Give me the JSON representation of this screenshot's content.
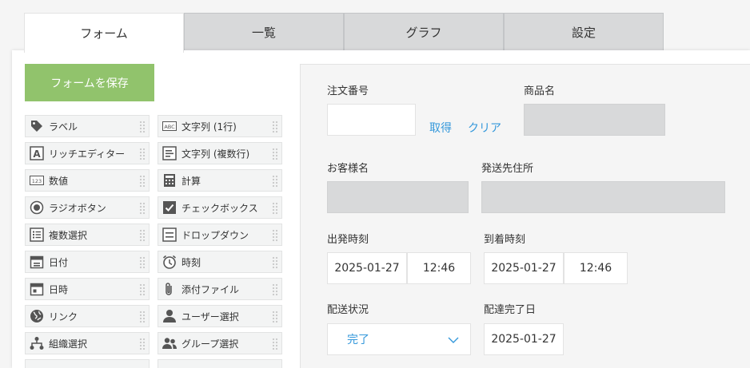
{
  "tabs": [
    {
      "label": "フォーム",
      "active": true
    },
    {
      "label": "一覧"
    },
    {
      "label": "グラフ"
    },
    {
      "label": "設定"
    }
  ],
  "save_button": "フォームを保存",
  "palette": [
    {
      "label": "ラベル",
      "icon": "tag-icon"
    },
    {
      "label": "文字列 (1行)",
      "icon": "text-single-line-icon"
    },
    {
      "label": "リッチエディター",
      "icon": "rich-editor-icon"
    },
    {
      "label": "文字列 (複数行)",
      "icon": "text-multi-line-icon"
    },
    {
      "label": "数値",
      "icon": "number-icon"
    },
    {
      "label": "計算",
      "icon": "calculator-icon"
    },
    {
      "label": "ラジオボタン",
      "icon": "radio-button-icon"
    },
    {
      "label": "チェックボックス",
      "icon": "checkbox-icon"
    },
    {
      "label": "複数選択",
      "icon": "multi-select-icon"
    },
    {
      "label": "ドロップダウン",
      "icon": "dropdown-icon"
    },
    {
      "label": "日付",
      "icon": "date-icon"
    },
    {
      "label": "時刻",
      "icon": "clock-icon"
    },
    {
      "label": "日時",
      "icon": "datetime-icon"
    },
    {
      "label": "添付ファイル",
      "icon": "paperclip-icon"
    },
    {
      "label": "リンク",
      "icon": "globe-icon"
    },
    {
      "label": "ユーザー選択",
      "icon": "user-icon"
    },
    {
      "label": "組織選択",
      "icon": "org-chart-icon"
    },
    {
      "label": "グループ選択",
      "icon": "group-icon"
    }
  ],
  "form": {
    "order_number": {
      "label": "注文番号",
      "fetch": "取得",
      "clear": "クリア"
    },
    "product_name": {
      "label": "商品名"
    },
    "customer_name": {
      "label": "お客様名"
    },
    "shipping_address": {
      "label": "発送先住所"
    },
    "departure": {
      "label": "出発時刻",
      "date": "2025-01-27",
      "time": "12:46"
    },
    "arrival": {
      "label": "到着時刻",
      "date": "2025-01-27",
      "time": "12:46"
    },
    "delivery_status": {
      "label": "配送状況",
      "value": "完了"
    },
    "delivery_done_date": {
      "label": "配達完了日",
      "date": "2025-01-27"
    }
  },
  "colors": {
    "save_button": "#91c36c",
    "link": "#3498db",
    "tab_inactive": "#d8d9da"
  }
}
